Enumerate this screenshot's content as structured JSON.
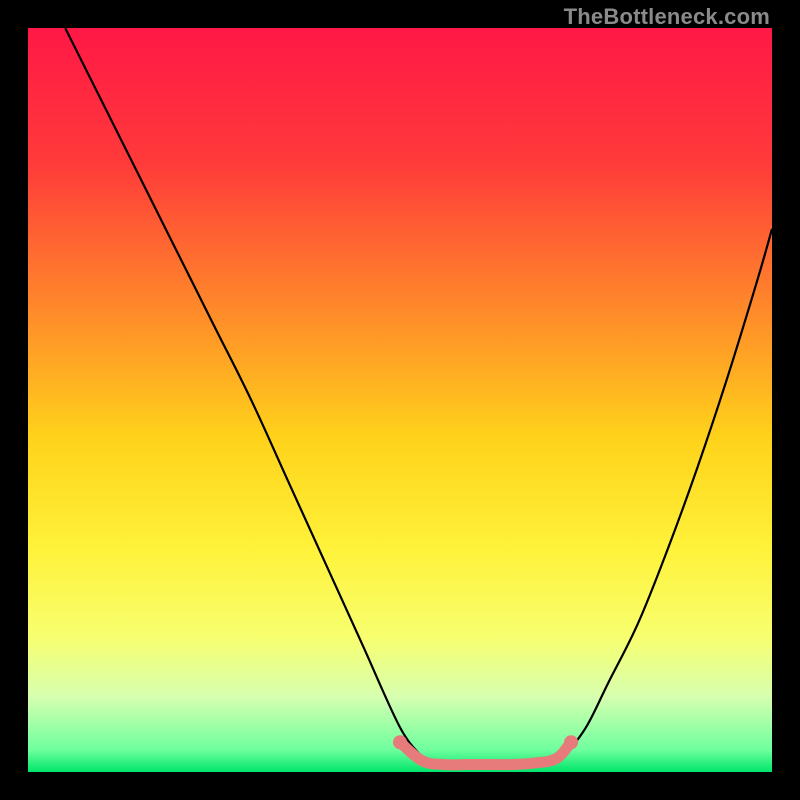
{
  "watermark": "TheBottleneck.com",
  "chart_data": {
    "type": "line",
    "title": "",
    "xlabel": "",
    "ylabel": "",
    "xlim": [
      0,
      100
    ],
    "ylim": [
      0,
      100
    ],
    "grid": false,
    "legend": false,
    "gradient_stops": [
      {
        "offset": 0,
        "color": "#ff1846"
      },
      {
        "offset": 18,
        "color": "#ff3a3a"
      },
      {
        "offset": 38,
        "color": "#ff8a2a"
      },
      {
        "offset": 55,
        "color": "#ffd21a"
      },
      {
        "offset": 70,
        "color": "#fff23a"
      },
      {
        "offset": 82,
        "color": "#f7ff70"
      },
      {
        "offset": 90,
        "color": "#d6ffb0"
      },
      {
        "offset": 97,
        "color": "#6fff9e"
      },
      {
        "offset": 100,
        "color": "#00e56a"
      }
    ],
    "series": [
      {
        "name": "left-curve",
        "x": [
          5,
          10,
          15,
          20,
          25,
          30,
          35,
          40,
          45,
          50,
          53
        ],
        "y": [
          100,
          90,
          80,
          70,
          60,
          50,
          39,
          28,
          17,
          6,
          2
        ]
      },
      {
        "name": "right-curve",
        "x": [
          72,
          75,
          78,
          82,
          86,
          90,
          94,
          98,
          100
        ],
        "y": [
          2,
          6,
          12,
          20,
          30,
          41,
          53,
          66,
          73
        ]
      }
    ],
    "flat_segment": {
      "name": "pink-flat",
      "color": "#e77a7a",
      "x": [
        50,
        53,
        56,
        59,
        62,
        65,
        68,
        71,
        73
      ],
      "y": [
        4,
        1.5,
        1,
        1,
        1,
        1,
        1.2,
        1.8,
        4
      ],
      "endpoints": [
        {
          "x": 50,
          "y": 4
        },
        {
          "x": 73,
          "y": 4
        }
      ]
    }
  }
}
